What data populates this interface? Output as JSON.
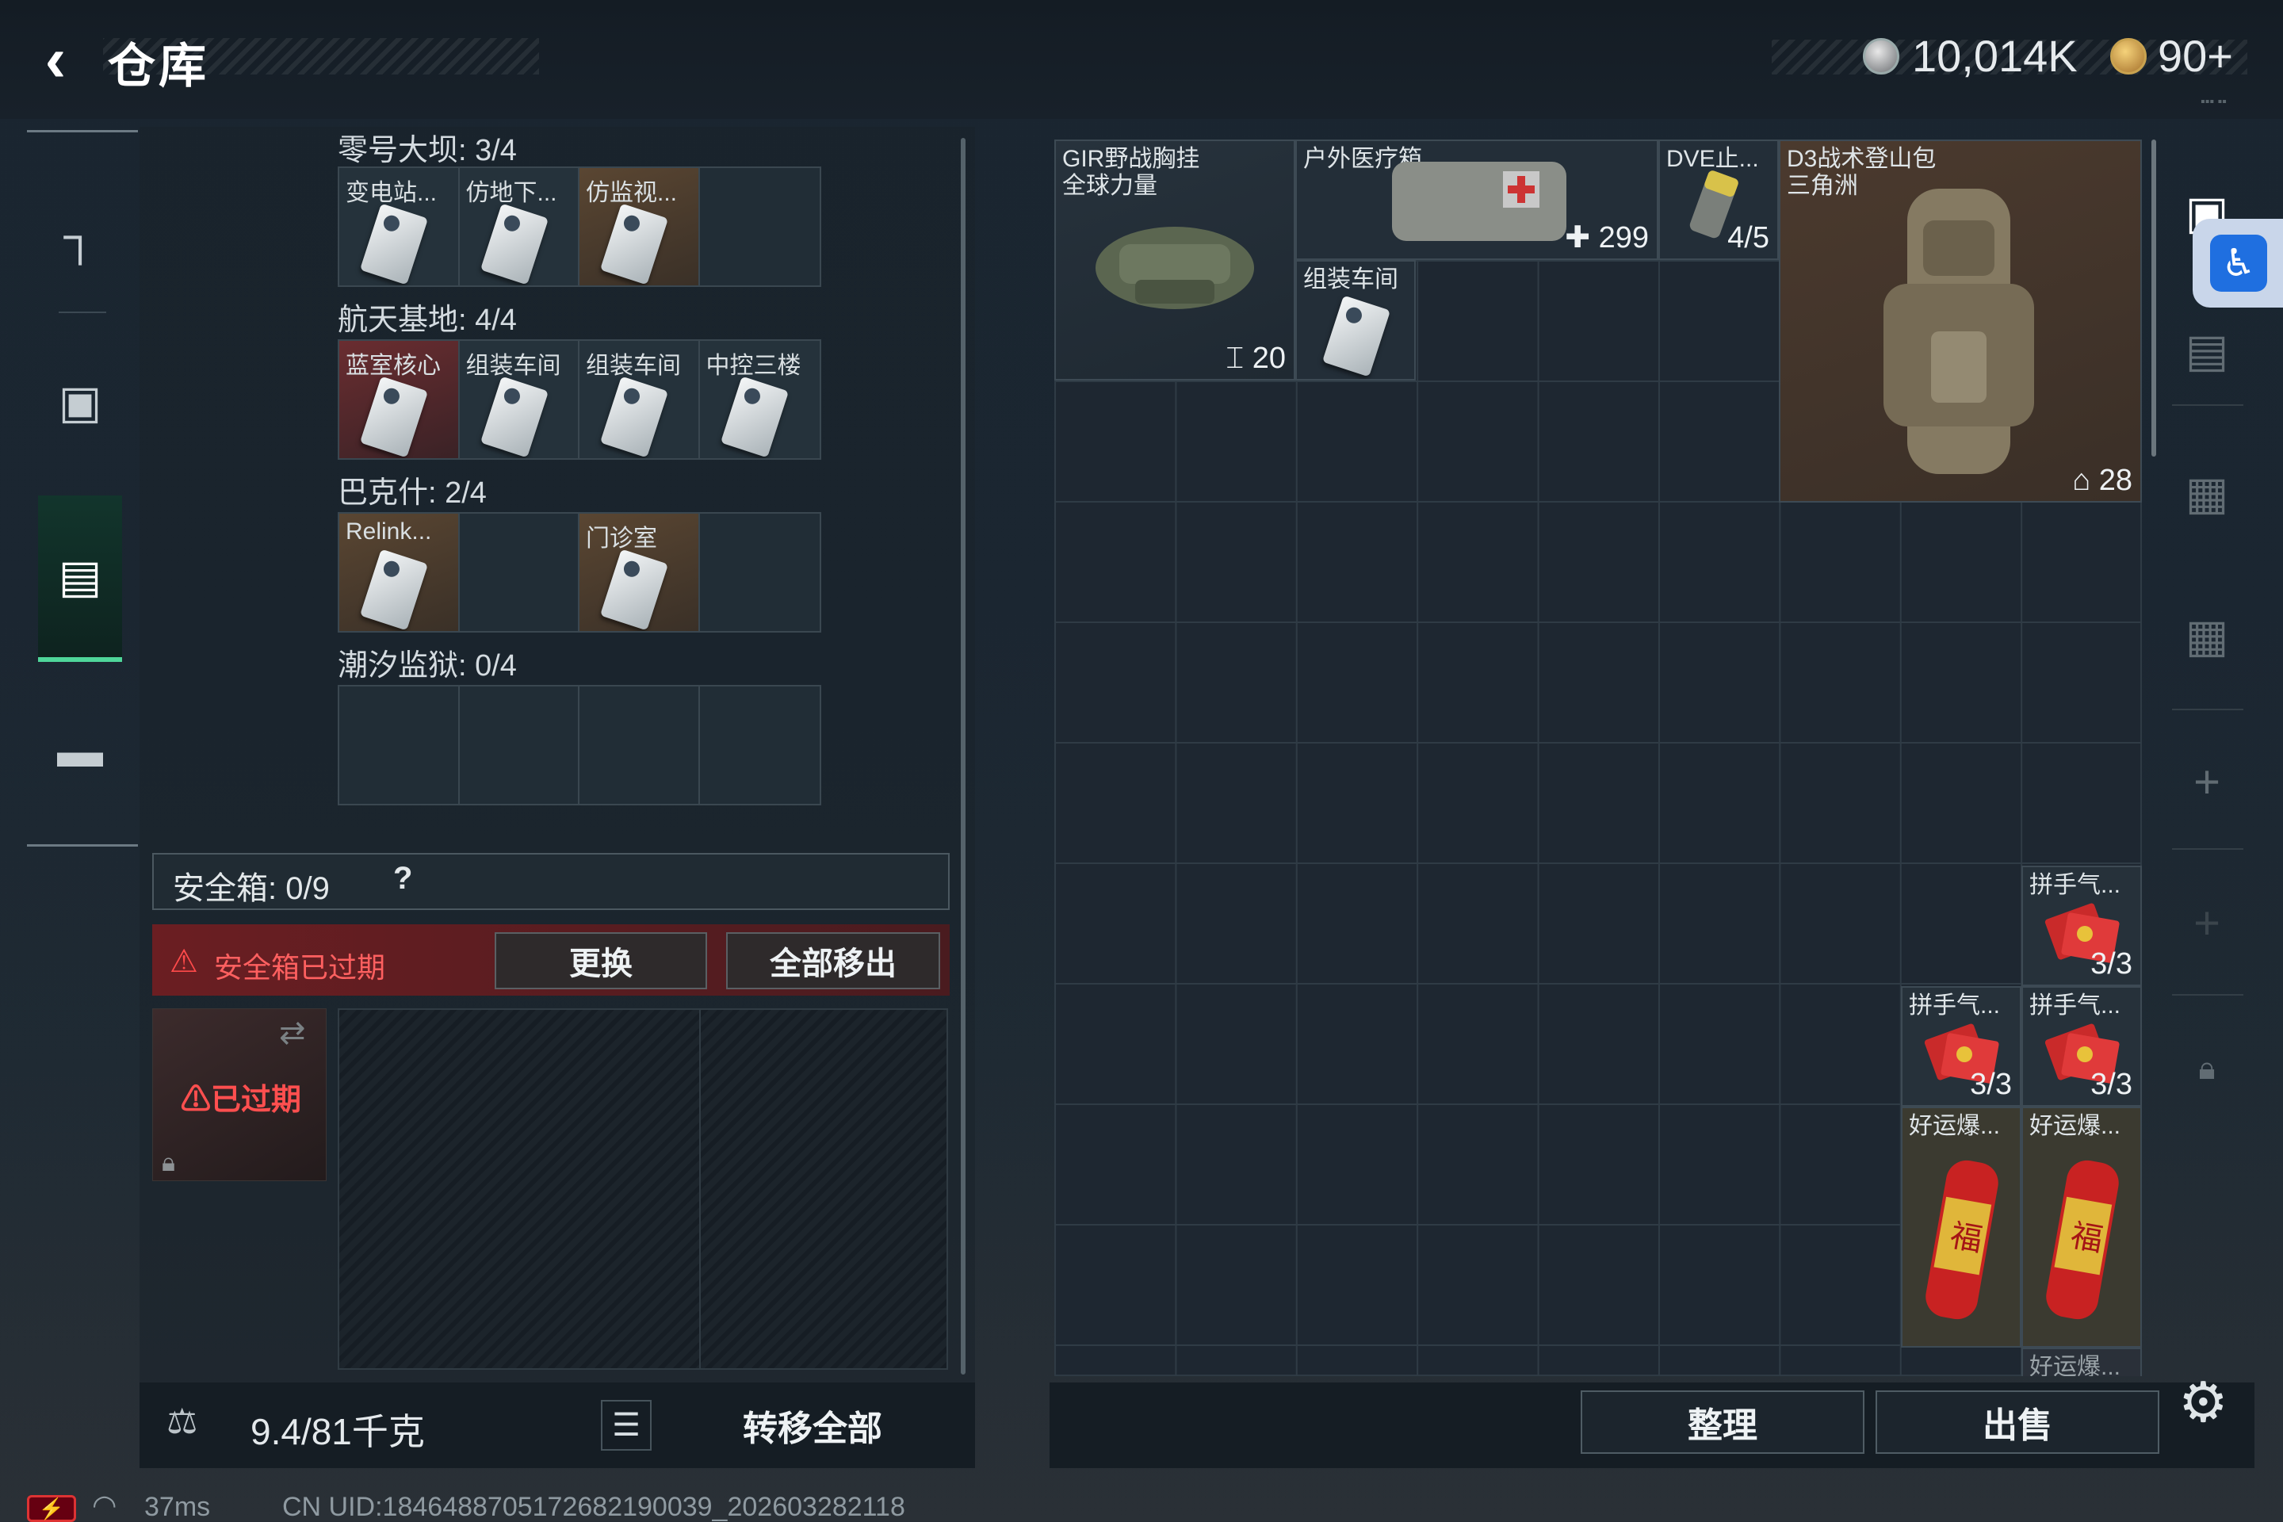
{
  "header": {
    "title": "仓库",
    "currency1": "10,014K",
    "currency2": "90+",
    "currency1_icon": "silver-coin-icon",
    "currency2_icon": "gold-coin-icon"
  },
  "sidebar": {
    "items": [
      {
        "name": "weapons",
        "icon": "gun-icon"
      },
      {
        "name": "equipment",
        "icon": "armor-icon"
      },
      {
        "name": "keys",
        "icon": "keycard-case-icon",
        "active": true
      },
      {
        "name": "toolbox",
        "icon": "toolbox-icon"
      }
    ]
  },
  "keys": {
    "groups": [
      {
        "title": "零号大坝: 3/4",
        "slots": [
          {
            "label": "变电站...",
            "filled": true,
            "tint": "blue"
          },
          {
            "label": "仿地下...",
            "filled": true,
            "tint": "blue"
          },
          {
            "label": "仿监视...",
            "filled": true,
            "tint": "gold"
          },
          {
            "label": "",
            "filled": false,
            "tint": "empty"
          }
        ]
      },
      {
        "title": "航天基地: 4/4",
        "slots": [
          {
            "label": "蓝室核心",
            "filled": true,
            "tint": "red"
          },
          {
            "label": "组装车间",
            "filled": true,
            "tint": "blue"
          },
          {
            "label": "组装车间",
            "filled": true,
            "tint": "blue"
          },
          {
            "label": "中控三楼",
            "filled": true,
            "tint": "blue"
          }
        ]
      },
      {
        "title": "巴克什: 2/4",
        "slots": [
          {
            "label": "Relink...",
            "filled": true,
            "tint": "gold"
          },
          {
            "label": "",
            "filled": false,
            "tint": "empty"
          },
          {
            "label": "门诊室",
            "filled": true,
            "tint": "gold"
          },
          {
            "label": "",
            "filled": false,
            "tint": "empty"
          }
        ]
      },
      {
        "title": "潮汐监狱: 0/4",
        "slots": [
          {
            "label": "",
            "filled": false,
            "tint": "empty"
          },
          {
            "label": "",
            "filled": false,
            "tint": "empty"
          },
          {
            "label": "",
            "filled": false,
            "tint": "empty"
          },
          {
            "label": "",
            "filled": false,
            "tint": "empty"
          }
        ]
      }
    ]
  },
  "safe": {
    "title": "安全箱: 0/9",
    "help": "?",
    "alert": "安全箱已过期",
    "replace": "更换",
    "remove_all": "全部移出",
    "expired": "已过期"
  },
  "footer_left": {
    "weight": "9.4/81千克",
    "transfer": "转移全部"
  },
  "stash": {
    "items": [
      {
        "label": "GIR野战胸挂\n全球力量",
        "count": "20",
        "count_icon": "vest-icon"
      },
      {
        "label": "户外医疗箱",
        "count": "299",
        "count_icon": "plus-icon"
      },
      {
        "label": "DVE止...",
        "count": "4/5"
      },
      {
        "label": "D3战术登山包\n三角洲",
        "count": "28",
        "count_icon": "backpack-icon"
      },
      {
        "label": "组装车间",
        "count": ""
      },
      {
        "label": "拼手气...",
        "count": "3/3"
      },
      {
        "label": "拼手气...",
        "count": "3/3"
      },
      {
        "label": "拼手气...",
        "count": "3/3"
      },
      {
        "label": "好运爆...",
        "count": ""
      },
      {
        "label": "好运爆...",
        "count": ""
      },
      {
        "label": "好运爆...",
        "count": ""
      }
    ],
    "sort": "整理",
    "sell": "出售"
  },
  "right_rail": {
    "icons": [
      "container-icon",
      "card-iv-icon",
      "camera-iv-icon",
      "camera-iv-icon-2",
      "add-icon",
      "add-icon-2",
      "lock-icon"
    ]
  },
  "status": {
    "ping": "37ms",
    "uid": "CN UID:1846488705172682190039_202603282118"
  },
  "colors": {
    "accent": "#4fd69a",
    "alert": "#ff4a4a",
    "panel": "#1e2731"
  }
}
